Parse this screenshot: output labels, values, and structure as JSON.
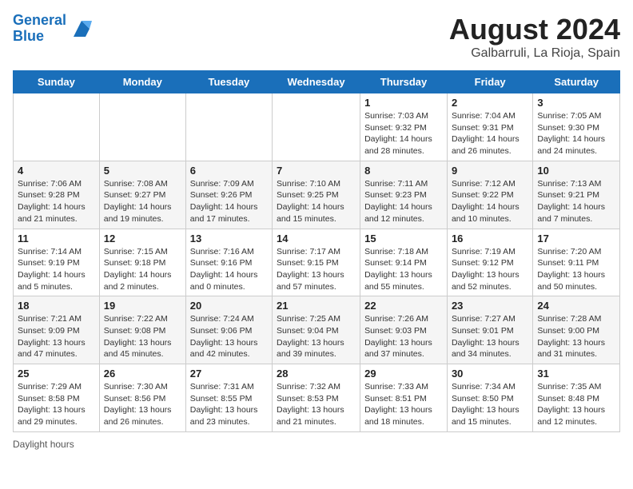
{
  "header": {
    "logo_line1": "General",
    "logo_line2": "Blue",
    "month": "August 2024",
    "location": "Galbarruli, La Rioja, Spain"
  },
  "days_of_week": [
    "Sunday",
    "Monday",
    "Tuesday",
    "Wednesday",
    "Thursday",
    "Friday",
    "Saturday"
  ],
  "weeks": [
    [
      {
        "day": "",
        "info": ""
      },
      {
        "day": "",
        "info": ""
      },
      {
        "day": "",
        "info": ""
      },
      {
        "day": "",
        "info": ""
      },
      {
        "day": "1",
        "info": "Sunrise: 7:03 AM\nSunset: 9:32 PM\nDaylight: 14 hours and 28 minutes."
      },
      {
        "day": "2",
        "info": "Sunrise: 7:04 AM\nSunset: 9:31 PM\nDaylight: 14 hours and 26 minutes."
      },
      {
        "day": "3",
        "info": "Sunrise: 7:05 AM\nSunset: 9:30 PM\nDaylight: 14 hours and 24 minutes."
      }
    ],
    [
      {
        "day": "4",
        "info": "Sunrise: 7:06 AM\nSunset: 9:28 PM\nDaylight: 14 hours and 21 minutes."
      },
      {
        "day": "5",
        "info": "Sunrise: 7:08 AM\nSunset: 9:27 PM\nDaylight: 14 hours and 19 minutes."
      },
      {
        "day": "6",
        "info": "Sunrise: 7:09 AM\nSunset: 9:26 PM\nDaylight: 14 hours and 17 minutes."
      },
      {
        "day": "7",
        "info": "Sunrise: 7:10 AM\nSunset: 9:25 PM\nDaylight: 14 hours and 15 minutes."
      },
      {
        "day": "8",
        "info": "Sunrise: 7:11 AM\nSunset: 9:23 PM\nDaylight: 14 hours and 12 minutes."
      },
      {
        "day": "9",
        "info": "Sunrise: 7:12 AM\nSunset: 9:22 PM\nDaylight: 14 hours and 10 minutes."
      },
      {
        "day": "10",
        "info": "Sunrise: 7:13 AM\nSunset: 9:21 PM\nDaylight: 14 hours and 7 minutes."
      }
    ],
    [
      {
        "day": "11",
        "info": "Sunrise: 7:14 AM\nSunset: 9:19 PM\nDaylight: 14 hours and 5 minutes."
      },
      {
        "day": "12",
        "info": "Sunrise: 7:15 AM\nSunset: 9:18 PM\nDaylight: 14 hours and 2 minutes."
      },
      {
        "day": "13",
        "info": "Sunrise: 7:16 AM\nSunset: 9:16 PM\nDaylight: 14 hours and 0 minutes."
      },
      {
        "day": "14",
        "info": "Sunrise: 7:17 AM\nSunset: 9:15 PM\nDaylight: 13 hours and 57 minutes."
      },
      {
        "day": "15",
        "info": "Sunrise: 7:18 AM\nSunset: 9:14 PM\nDaylight: 13 hours and 55 minutes."
      },
      {
        "day": "16",
        "info": "Sunrise: 7:19 AM\nSunset: 9:12 PM\nDaylight: 13 hours and 52 minutes."
      },
      {
        "day": "17",
        "info": "Sunrise: 7:20 AM\nSunset: 9:11 PM\nDaylight: 13 hours and 50 minutes."
      }
    ],
    [
      {
        "day": "18",
        "info": "Sunrise: 7:21 AM\nSunset: 9:09 PM\nDaylight: 13 hours and 47 minutes."
      },
      {
        "day": "19",
        "info": "Sunrise: 7:22 AM\nSunset: 9:08 PM\nDaylight: 13 hours and 45 minutes."
      },
      {
        "day": "20",
        "info": "Sunrise: 7:24 AM\nSunset: 9:06 PM\nDaylight: 13 hours and 42 minutes."
      },
      {
        "day": "21",
        "info": "Sunrise: 7:25 AM\nSunset: 9:04 PM\nDaylight: 13 hours and 39 minutes."
      },
      {
        "day": "22",
        "info": "Sunrise: 7:26 AM\nSunset: 9:03 PM\nDaylight: 13 hours and 37 minutes."
      },
      {
        "day": "23",
        "info": "Sunrise: 7:27 AM\nSunset: 9:01 PM\nDaylight: 13 hours and 34 minutes."
      },
      {
        "day": "24",
        "info": "Sunrise: 7:28 AM\nSunset: 9:00 PM\nDaylight: 13 hours and 31 minutes."
      }
    ],
    [
      {
        "day": "25",
        "info": "Sunrise: 7:29 AM\nSunset: 8:58 PM\nDaylight: 13 hours and 29 minutes."
      },
      {
        "day": "26",
        "info": "Sunrise: 7:30 AM\nSunset: 8:56 PM\nDaylight: 13 hours and 26 minutes."
      },
      {
        "day": "27",
        "info": "Sunrise: 7:31 AM\nSunset: 8:55 PM\nDaylight: 13 hours and 23 minutes."
      },
      {
        "day": "28",
        "info": "Sunrise: 7:32 AM\nSunset: 8:53 PM\nDaylight: 13 hours and 21 minutes."
      },
      {
        "day": "29",
        "info": "Sunrise: 7:33 AM\nSunset: 8:51 PM\nDaylight: 13 hours and 18 minutes."
      },
      {
        "day": "30",
        "info": "Sunrise: 7:34 AM\nSunset: 8:50 PM\nDaylight: 13 hours and 15 minutes."
      },
      {
        "day": "31",
        "info": "Sunrise: 7:35 AM\nSunset: 8:48 PM\nDaylight: 13 hours and 12 minutes."
      }
    ]
  ],
  "footer": {
    "note": "Daylight hours"
  }
}
